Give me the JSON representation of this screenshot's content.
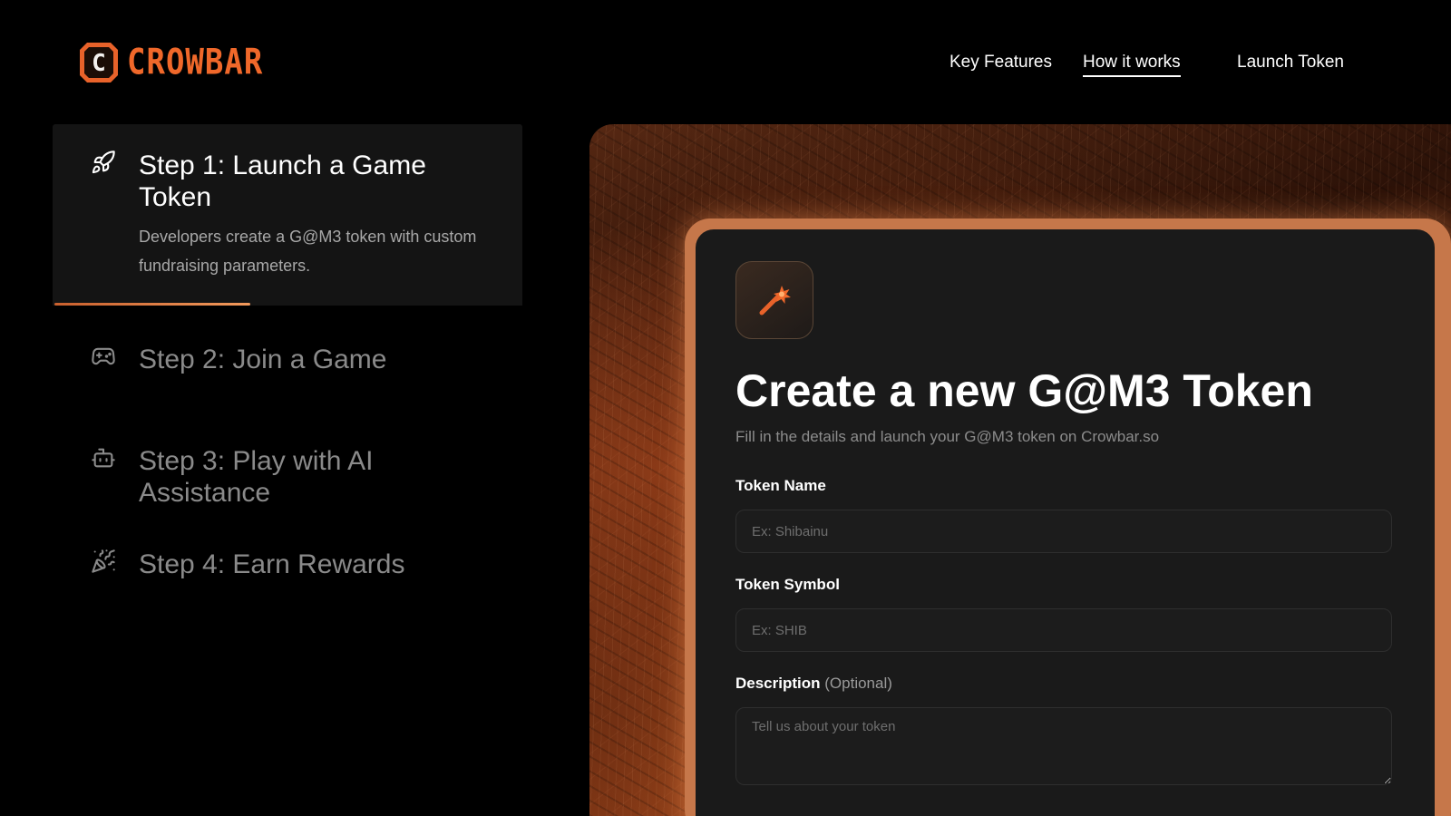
{
  "brand": {
    "name": "CROWBAR",
    "logo_letter": "C",
    "accent_color": "#f0682a"
  },
  "nav": {
    "items": [
      {
        "label": "Key Features",
        "icon": null,
        "active": false
      },
      {
        "label": "How it works",
        "icon": null,
        "active": true
      },
      {
        "label": "Launch Token",
        "icon": null,
        "active": false
      }
    ]
  },
  "steps": [
    {
      "title": "Step 1: Launch a Game Token",
      "description": "Developers create a G@M3 token with custom fundraising parameters.",
      "icon": "rocket-icon",
      "active": true,
      "progress": 0.42
    },
    {
      "title": "Step 2: Join a Game",
      "description": "",
      "icon": "gamepad-icon",
      "active": false
    },
    {
      "title": "Step 3: Play with AI Assistance",
      "description": "",
      "icon": "robot-icon",
      "active": false
    },
    {
      "title": "Step 4: Earn Rewards",
      "description": "",
      "icon": "party-popper-icon",
      "active": false
    }
  ],
  "form_card": {
    "icon": "magic-wand-icon",
    "title": "Create a new G@M3 Token",
    "subtitle": "Fill in the details and launch your G@M3 token on Crowbar.so",
    "fields": {
      "token_name": {
        "label": "Token Name",
        "placeholder": "Ex: Shibainu",
        "value": ""
      },
      "token_symbol": {
        "label": "Token Symbol",
        "placeholder": "Ex: SHIB",
        "value": ""
      },
      "description": {
        "label": "Description",
        "optional_label": "(Optional)",
        "placeholder": "Tell us about your token",
        "value": ""
      }
    }
  }
}
